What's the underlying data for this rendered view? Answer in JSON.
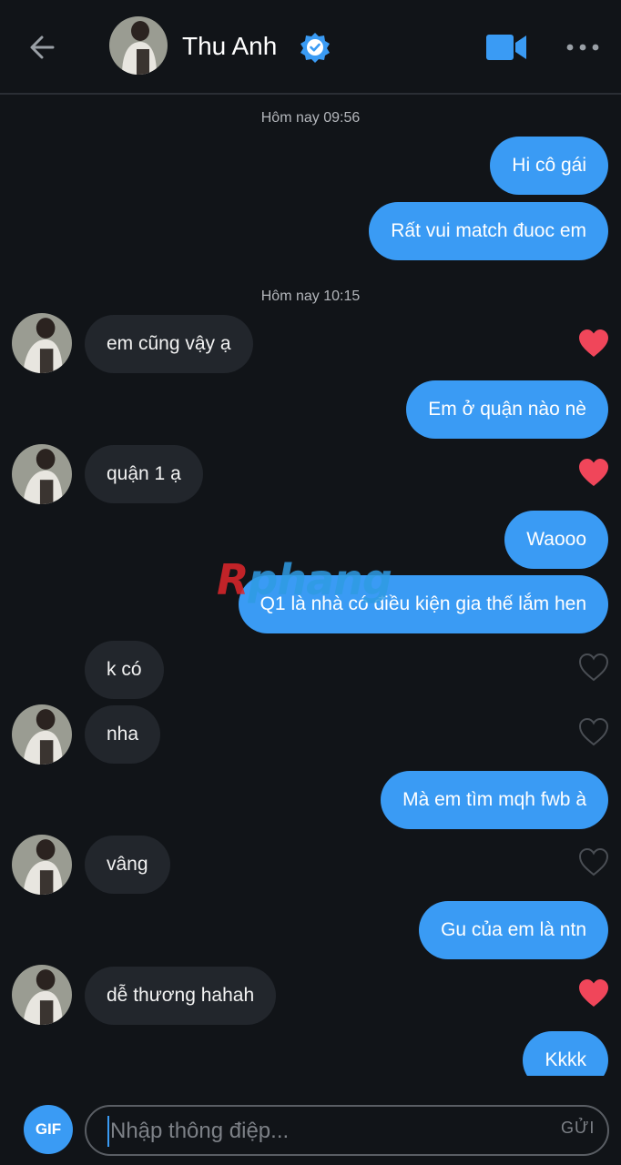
{
  "header": {
    "contact_name": "Thu Anh",
    "icons": [
      "back-arrow-icon",
      "verified-badge-icon",
      "video-call-icon",
      "more-options-icon"
    ],
    "accent": "#3a9bf4"
  },
  "conversation": {
    "timestamps": [
      "Hôm nay 09:56",
      "Hôm nay 10:15"
    ],
    "messages": [
      {
        "from": "me",
        "text": "Hi cô gái"
      },
      {
        "from": "me",
        "text": "Rất vui match đuoc em"
      },
      {
        "from": "them",
        "text": "em cũng vậy ạ",
        "liked": true
      },
      {
        "from": "me",
        "text": "Em ở quận nào nè"
      },
      {
        "from": "them",
        "text": "quận 1 ạ",
        "liked": true
      },
      {
        "from": "me",
        "text": "Waooo"
      },
      {
        "from": "me",
        "text": "Q1 là nhà có điều kiện gia thế lắm hen"
      },
      {
        "from": "them",
        "text": "k có",
        "liked": false
      },
      {
        "from": "them",
        "text": "nha",
        "liked": false
      },
      {
        "from": "me",
        "text": "Mà em tìm mqh fwb à"
      },
      {
        "from": "them",
        "text": "vâng",
        "liked": false
      },
      {
        "from": "me",
        "text": "Gu của em là ntn"
      },
      {
        "from": "them",
        "text": "dễ thương hahah",
        "liked": true
      },
      {
        "from": "me",
        "text": "Kkkk"
      }
    ],
    "liked_color": "#f0465a",
    "unliked_color": "#4a4e54"
  },
  "watermark": {
    "first": "R",
    "rest": "phang"
  },
  "composer": {
    "gif_label": "GIF",
    "placeholder": "Nhập thông điệp...",
    "send_label": "GỬI"
  }
}
